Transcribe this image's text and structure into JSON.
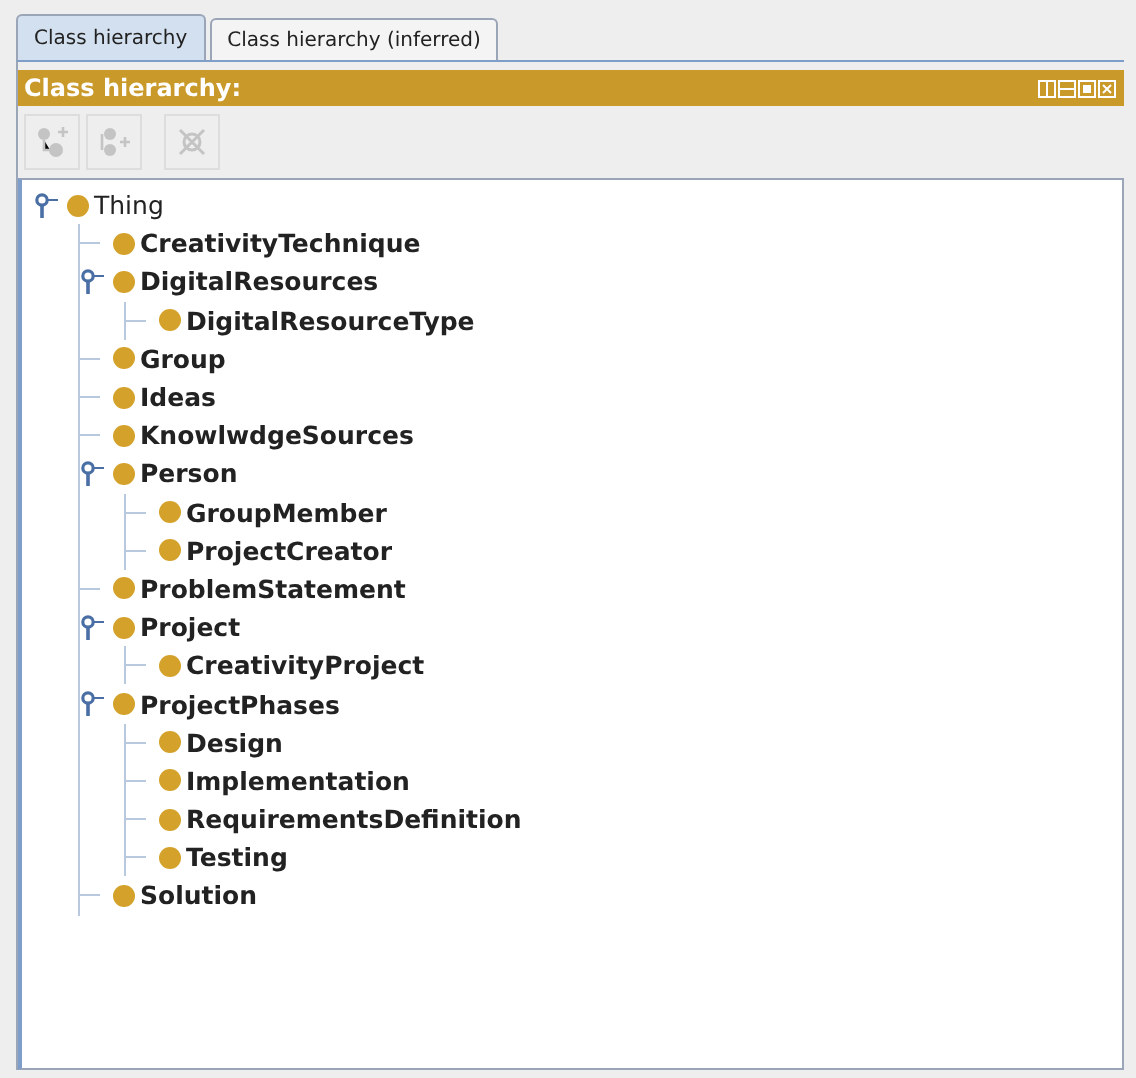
{
  "tabs": [
    {
      "label": "Class hierarchy",
      "selected": true
    },
    {
      "label": "Class hierarchy (inferred)",
      "selected": false
    }
  ],
  "panel": {
    "title": "Class hierarchy:"
  },
  "toolbar": [
    {
      "kind": "add-subclass",
      "disabled": true
    },
    {
      "kind": "add-sibling",
      "disabled": true
    },
    {
      "kind": "delete",
      "disabled": true
    }
  ],
  "tree": [
    {
      "label": "Thing",
      "expanded": true,
      "children": [
        {
          "label": "CreativityTechnique"
        },
        {
          "label": "DigitalResources",
          "expanded": true,
          "children": [
            {
              "label": "DigitalResourceType"
            }
          ]
        },
        {
          "label": "Group"
        },
        {
          "label": "Ideas"
        },
        {
          "label": "KnowlwdgeSources"
        },
        {
          "label": "Person",
          "expanded": true,
          "children": [
            {
              "label": "GroupMember"
            },
            {
              "label": "ProjectCreator"
            }
          ]
        },
        {
          "label": "ProblemStatement"
        },
        {
          "label": "Project",
          "expanded": true,
          "children": [
            {
              "label": "CreativityProject"
            }
          ]
        },
        {
          "label": "ProjectPhases",
          "expanded": true,
          "children": [
            {
              "label": "Design"
            },
            {
              "label": "Implementation"
            },
            {
              "label": "RequirementsDefinition"
            },
            {
              "label": "Testing"
            }
          ]
        },
        {
          "label": "Solution"
        }
      ]
    }
  ]
}
